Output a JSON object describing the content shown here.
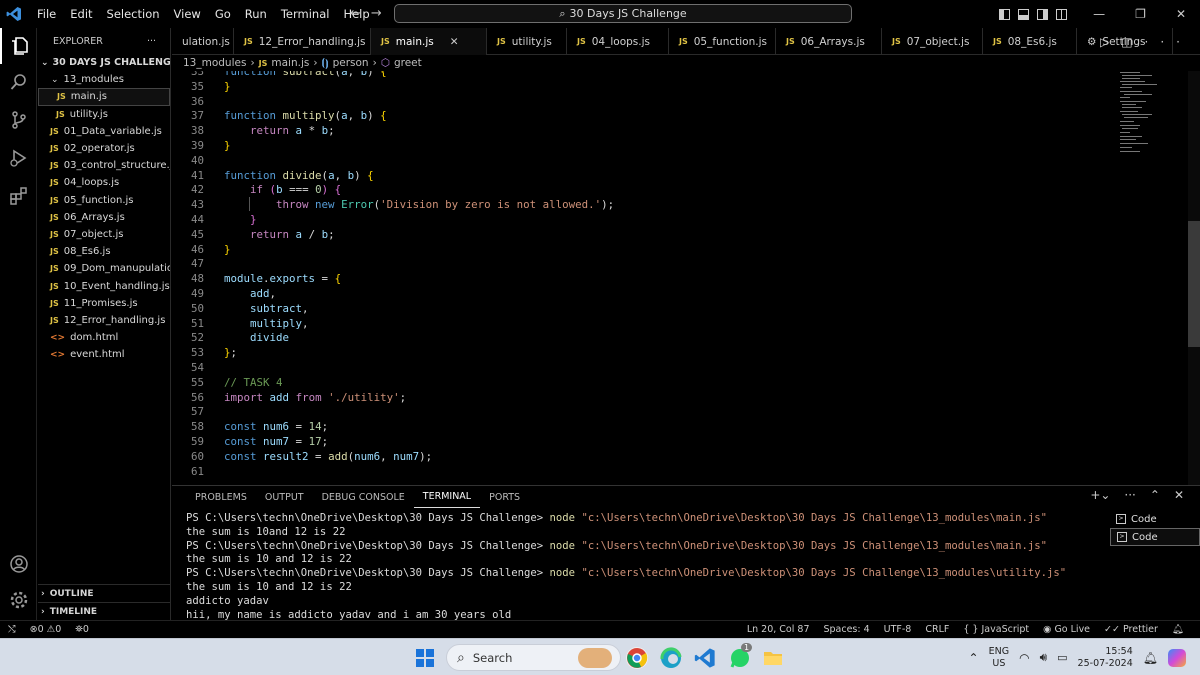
{
  "menu": [
    "File",
    "Edit",
    "Selection",
    "View",
    "Go",
    "Run",
    "Terminal",
    "Help"
  ],
  "search": {
    "title": "30 Days JS Challenge"
  },
  "explorer": {
    "header": "EXPLORER",
    "root": "30 DAYS JS CHALLENGE",
    "folder": "13_modules",
    "folder_files": [
      "main.js",
      "utility.js"
    ],
    "files": [
      {
        "name": "01_Data_variable.js",
        "type": "js"
      },
      {
        "name": "02_operator.js",
        "type": "js"
      },
      {
        "name": "03_control_structure.js",
        "type": "js"
      },
      {
        "name": "04_loops.js",
        "type": "js"
      },
      {
        "name": "05_function.js",
        "type": "js"
      },
      {
        "name": "06_Arrays.js",
        "type": "js"
      },
      {
        "name": "07_object.js",
        "type": "js"
      },
      {
        "name": "08_Es6.js",
        "type": "js"
      },
      {
        "name": "09_Dom_manupulatio...",
        "type": "js"
      },
      {
        "name": "10_Event_handling.js",
        "type": "js"
      },
      {
        "name": "11_Promises.js",
        "type": "js"
      },
      {
        "name": "12_Error_handling.js",
        "type": "js"
      },
      {
        "name": "dom.html",
        "type": "html"
      },
      {
        "name": "event.html",
        "type": "html"
      }
    ],
    "outline": "OUTLINE",
    "timeline": "TIMELINE"
  },
  "tabs": [
    {
      "label": "ulation.js",
      "icon": false
    },
    {
      "label": "12_Error_handling.js",
      "icon": true
    },
    {
      "label": "main.js",
      "icon": true,
      "active": true
    },
    {
      "label": "utility.js",
      "icon": true
    },
    {
      "label": "04_loops.js",
      "icon": true
    },
    {
      "label": "05_function.js",
      "icon": true
    },
    {
      "label": "06_Arrays.js",
      "icon": true
    },
    {
      "label": "07_object.js",
      "icon": true
    },
    {
      "label": "08_Es6.js",
      "icon": true
    },
    {
      "label": "Settings",
      "icon": false,
      "settings": true
    }
  ],
  "breadcrumb": [
    "13_modules",
    "JS",
    "main.js",
    "person",
    "greet"
  ],
  "code_lines": [
    {
      "n": "33",
      "html": "<span class='kw'>function</span> <span class='fn'>subtract</span>(<span class='var'>a</span>, <span class='var'>b</span>) <span class='br'>{</span>"
    },
    {
      "n": "35",
      "html": "<span class='br'>}</span>"
    },
    {
      "n": "36",
      "html": ""
    },
    {
      "n": "37",
      "html": "<span class='kw'>function</span> <span class='fn'>multiply</span>(<span class='var'>a</span>, <span class='var'>b</span>) <span class='br'>{</span>"
    },
    {
      "n": "38",
      "html": "    <span class='ctl'>return</span> <span class='var'>a</span> * <span class='var'>b</span>;"
    },
    {
      "n": "39",
      "html": "<span class='br'>}</span>"
    },
    {
      "n": "40",
      "html": ""
    },
    {
      "n": "41",
      "html": "<span class='kw'>function</span> <span class='fn'>divide</span>(<span class='var'>a</span>, <span class='var'>b</span>) <span class='br'>{</span>"
    },
    {
      "n": "42",
      "html": "    <span class='ctl'>if</span> <span class='br2'>(</span><span class='var'>b</span> === <span class='num'>0</span><span class='br2'>)</span> <span class='br2'>{</span>"
    },
    {
      "n": "43",
      "html": "        <span class='ctl'>throw</span> <span class='kw'>new</span> <span class='cls'>Error</span>(<span class='str'>'Division by zero is not allowed.'</span>);"
    },
    {
      "n": "44",
      "html": "    <span class='br2'>}</span>"
    },
    {
      "n": "45",
      "html": "    <span class='ctl'>return</span> <span class='var'>a</span> / <span class='var'>b</span>;"
    },
    {
      "n": "46",
      "html": "<span class='br'>}</span>"
    },
    {
      "n": "47",
      "html": ""
    },
    {
      "n": "48",
      "html": "<span class='var'>module</span>.<span class='var'>exports</span> = <span class='br'>{</span>"
    },
    {
      "n": "49",
      "html": "    <span class='var'>add</span>,"
    },
    {
      "n": "50",
      "html": "    <span class='var'>subtract</span>,"
    },
    {
      "n": "51",
      "html": "    <span class='var'>multiply</span>,"
    },
    {
      "n": "52",
      "html": "    <span class='var'>divide</span>"
    },
    {
      "n": "53",
      "html": "<span class='br'>}</span>;"
    },
    {
      "n": "54",
      "html": ""
    },
    {
      "n": "55",
      "html": "<span class='cm'>// TASK 4</span>"
    },
    {
      "n": "56",
      "html": "<span class='ctl'>import</span> <span class='var'>add</span> <span class='ctl'>from</span> <span class='str'>'./utility'</span>;"
    },
    {
      "n": "57",
      "html": ""
    },
    {
      "n": "58",
      "html": "<span class='kw'>const</span> <span class='var'>num6</span> = <span class='num'>14</span>;"
    },
    {
      "n": "59",
      "html": "<span class='kw'>const</span> <span class='var'>num7</span> = <span class='num'>17</span>;"
    },
    {
      "n": "60",
      "html": "<span class='kw'>const</span> <span class='var'>result2</span> = <span class='fn'>add</span>(<span class='var'>num6</span>, <span class='var'>num7</span>);"
    },
    {
      "n": "61",
      "html": ""
    }
  ],
  "panel_tabs": [
    "PROBLEMS",
    "OUTPUT",
    "DEBUG CONSOLE",
    "TERMINAL",
    "PORTS"
  ],
  "terminal": [
    {
      "prompt": "PS C:\\Users\\techn\\OneDrive\\Desktop\\30 Days JS Challenge> ",
      "cmd": "node ",
      "path": "\"c:\\Users\\techn\\OneDrive\\Desktop\\30 Days JS Challenge\\13_modules\\main.js\""
    },
    {
      "text": "the sum is 10and 12 is 22"
    },
    {
      "prompt": "PS C:\\Users\\techn\\OneDrive\\Desktop\\30 Days JS Challenge> ",
      "cmd": "node ",
      "path": "\"c:\\Users\\techn\\OneDrive\\Desktop\\30 Days JS Challenge\\13_modules\\main.js\""
    },
    {
      "text": "the sum is 10 and 12 is 22"
    },
    {
      "prompt": "PS C:\\Users\\techn\\OneDrive\\Desktop\\30 Days JS Challenge> ",
      "cmd": "node ",
      "path": "\"c:\\Users\\techn\\OneDrive\\Desktop\\30 Days JS Challenge\\13_modules\\utility.js\""
    },
    {
      "text": "the sum is 10 and 12 is 22"
    },
    {
      "text": "addicto yadav"
    },
    {
      "text": "hii, my name is addicto yadav and i am 30 years old"
    }
  ],
  "terminal_list": [
    "Code",
    "Code"
  ],
  "status": {
    "errors": "0",
    "warnings": "0",
    "ports": "0",
    "position": "Ln 20, Col 87",
    "spaces": "Spaces: 4",
    "encoding": "UTF-8",
    "eol": "CRLF",
    "language": "JavaScript",
    "golive": "Go Live",
    "prettier": "Prettier"
  },
  "taskbar": {
    "search_placeholder": "Search",
    "lang_top": "ENG",
    "lang_bottom": "US",
    "time": "15:54",
    "date": "25-07-2024",
    "whatsapp_badge": "1"
  }
}
